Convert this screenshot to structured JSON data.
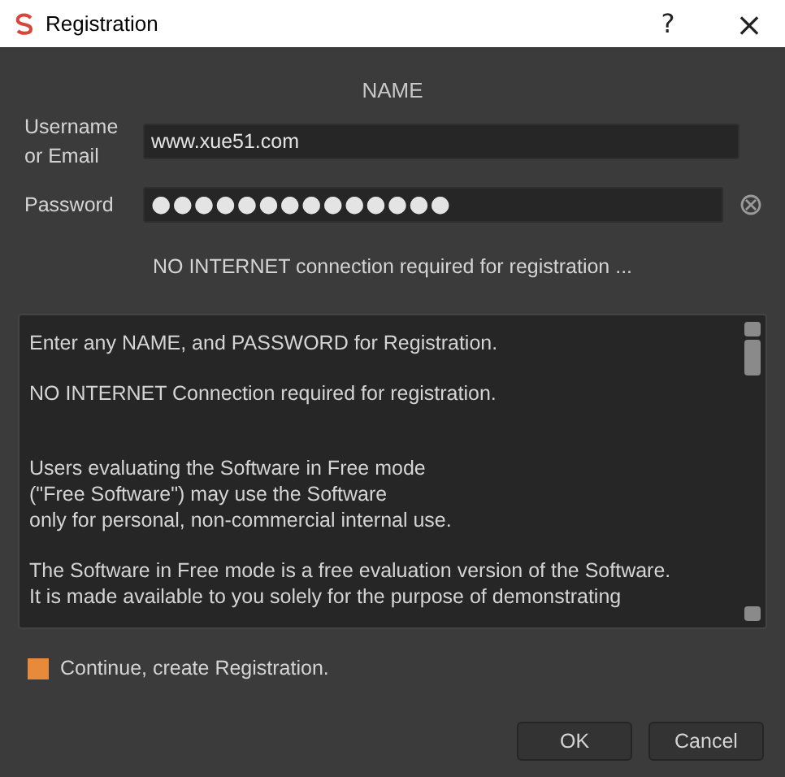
{
  "window": {
    "title": "Registration",
    "help": "?",
    "close": "×"
  },
  "heading": "NAME",
  "fields": [
    {
      "label": "Username or Email",
      "value": "www.xue51.com",
      "kind": "text"
    },
    {
      "label": "Password",
      "value": "●●●●●●●●●●●●●●",
      "kind": "password"
    }
  ],
  "notice": "NO INTERNET connection required for registration ...",
  "terms": [
    [
      "Enter any NAME, and PASSWORD for Registration."
    ],
    [
      "NO INTERNET Connection required for registration."
    ],
    [
      "Users evaluating the Software in Free mode",
      "(\"Free Software\") may use the Software",
      "only for personal, non-commercial internal use."
    ],
    [
      "The Software in Free mode is a free evaluation version of the Software.",
      "It is made available to you solely for the purpose of demonstrating"
    ]
  ],
  "continue": {
    "label": "Continue, create Registration.",
    "checked": true
  },
  "buttons": [
    "OK",
    "Cancel"
  ]
}
